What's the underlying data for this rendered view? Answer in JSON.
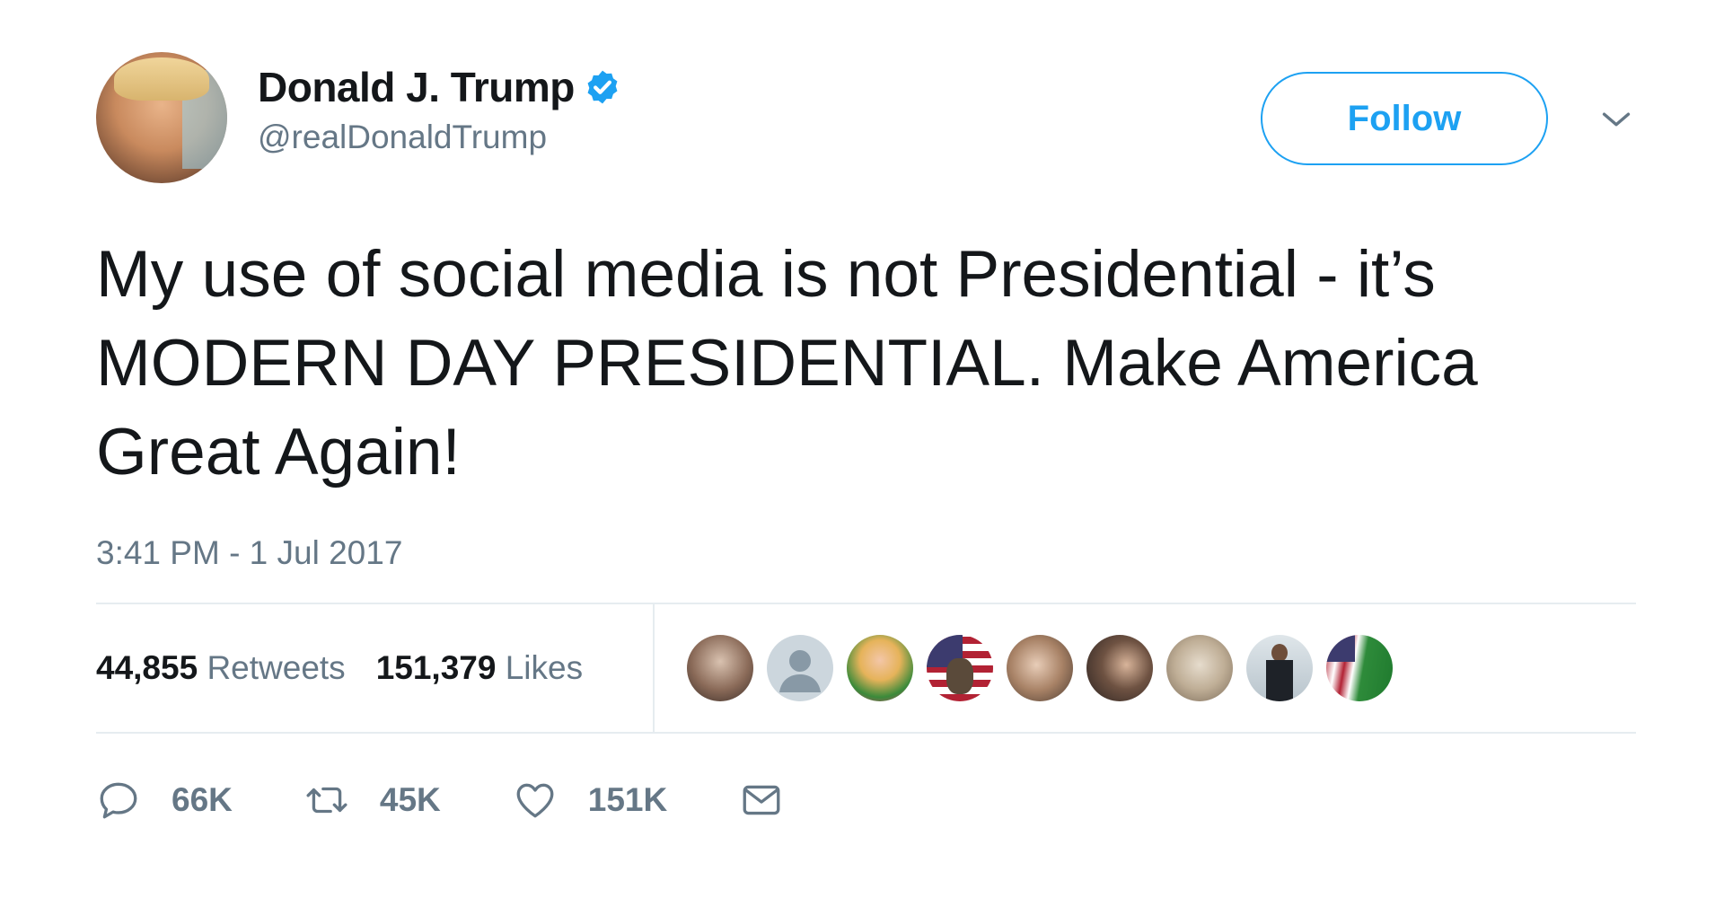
{
  "tweet": {
    "author": {
      "name": "Donald J. Trump",
      "handle": "@realDonaldTrump",
      "verified": true
    },
    "follow_label": "Follow",
    "text": "My use of social media is not Presidential - it’s MODERN DAY PRESIDENTIAL. Make America Great Again!",
    "timestamp": "3:41 PM - 1 Jul 2017",
    "stats": {
      "retweets_count": "44,855",
      "retweets_label": "Retweets",
      "likes_count": "151,379",
      "likes_label": "Likes"
    },
    "liker_avatars": [
      {
        "icon": "person-with-glasses-avatar"
      },
      {
        "icon": "default-profile-avatar"
      },
      {
        "icon": "blonde-woman-avatar"
      },
      {
        "icon": "flag-eagle-avatar"
      },
      {
        "icon": "woman-with-child-avatar"
      },
      {
        "icon": "woman-portrait-avatar"
      },
      {
        "icon": "cat-avatar"
      },
      {
        "icon": "man-in-suit-avatar"
      },
      {
        "icon": "us-saudi-flag-avatar"
      }
    ],
    "actions": {
      "reply_count": "66K",
      "retweet_count": "45K",
      "like_count": "151K"
    }
  },
  "colors": {
    "accent": "#1da1f2",
    "verified": "#1da1f2",
    "text_primary": "#14171a",
    "text_secondary": "#657786",
    "divider": "#e6ecf0"
  }
}
